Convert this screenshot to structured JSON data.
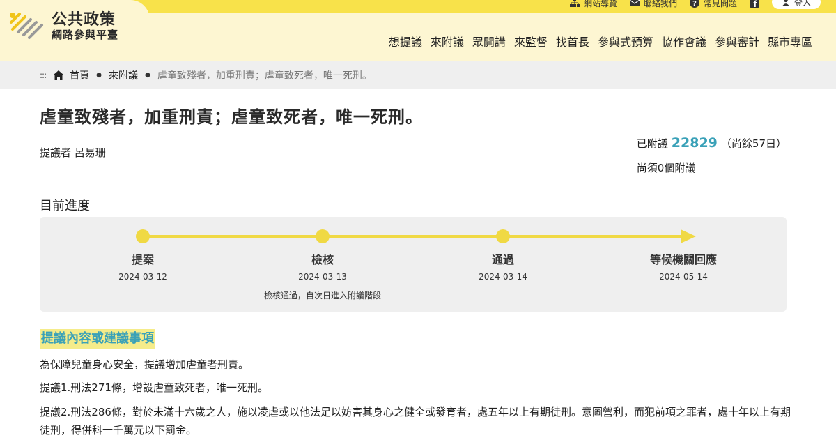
{
  "header": {
    "brand_title": "公共政策",
    "brand_subtitle": "網路參與平臺",
    "utility_links": [
      {
        "label": "網站導覽",
        "icon": "sitemap-icon"
      },
      {
        "label": "聯絡我們",
        "icon": "mail-icon"
      },
      {
        "label": "常見問題",
        "icon": "question-icon"
      }
    ],
    "login_label": "登入",
    "nav": [
      "想提議",
      "來附議",
      "眾開講",
      "來監督",
      "找首長",
      "參與式預算",
      "協作會議",
      "參與審計",
      "縣市專區"
    ],
    "colors": {
      "band": "#f8e24a",
      "background": "#fdf6d2"
    }
  },
  "breadcrumb": {
    "dots": ":::",
    "home": "首頁",
    "level2": "來附議",
    "current": "虐童致殘者，加重刑責；虐童致死者，唯一死刑。"
  },
  "proposal": {
    "title": "虐童致殘者，加重刑責；虐童致死者，唯一死刑。",
    "proposer_label": "提議者",
    "proposer_name": "呂易珊",
    "signed_label": "已附議",
    "signed_count": "22829",
    "remaining_days": "（尚餘57日）",
    "needed_text": "尚須0個附議"
  },
  "progress": {
    "label": "目前進度",
    "stages": [
      {
        "name": "提案",
        "date": "2024-03-12",
        "note": ""
      },
      {
        "name": "檢核",
        "date": "2024-03-13",
        "note": "檢核通過，自次日進入附議階段"
      },
      {
        "name": "通過",
        "date": "2024-03-14",
        "note": ""
      },
      {
        "name": "等候機關回應",
        "date": "2024-05-14",
        "note": ""
      }
    ],
    "accent_color": "#f0d944"
  },
  "content": {
    "heading": "提議內容或建議事項",
    "paragraphs": [
      "為保障兒童身心安全，提議增加虐童者刑責。",
      "提議1.刑法271條，增設虐童致死者，唯一死刑。",
      "提議2.刑法286條，對於未滿十六歲之人，施以凌虐或以他法足以妨害其身心之健全或發育者，處五年以上有期徒刑。意圖營利，而犯前項之罪者，處十年以上有期徒刑，得併科一千萬元以下罰金。"
    ]
  }
}
